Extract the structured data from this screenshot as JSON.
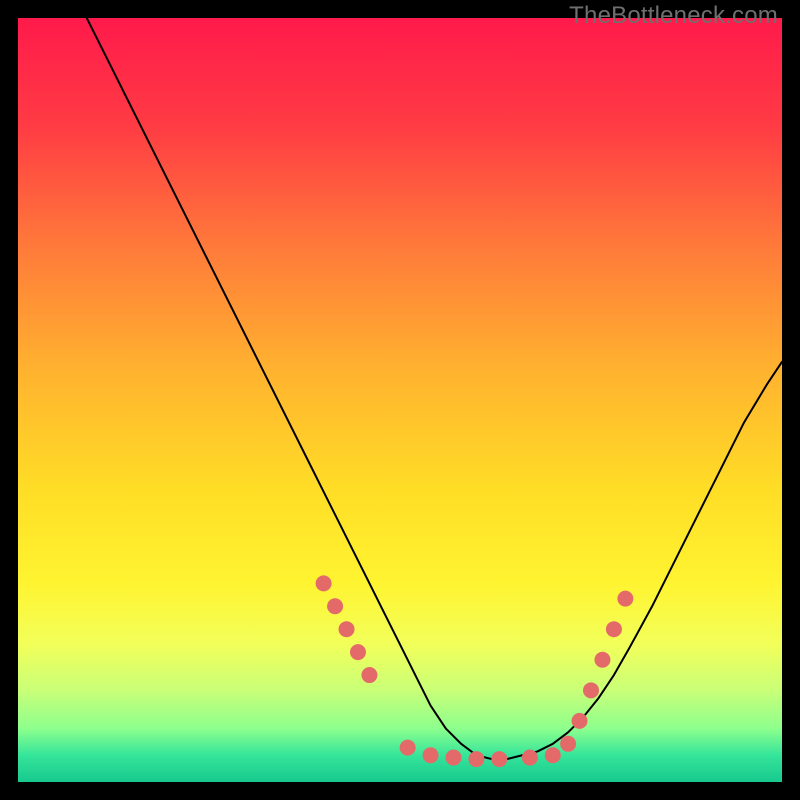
{
  "watermark": "TheBottleneck.com",
  "chart_data": {
    "type": "line",
    "title": "",
    "xlabel": "",
    "ylabel": "",
    "xlim": [
      0,
      100
    ],
    "ylim": [
      0,
      100
    ],
    "background_gradient": {
      "stops": [
        {
          "offset": 0.0,
          "color": "#ff1a4b"
        },
        {
          "offset": 0.14,
          "color": "#ff3b44"
        },
        {
          "offset": 0.3,
          "color": "#ff7a3a"
        },
        {
          "offset": 0.46,
          "color": "#ffb22f"
        },
        {
          "offset": 0.62,
          "color": "#ffde26"
        },
        {
          "offset": 0.74,
          "color": "#fff431"
        },
        {
          "offset": 0.82,
          "color": "#f2ff5a"
        },
        {
          "offset": 0.88,
          "color": "#c9ff77"
        },
        {
          "offset": 0.93,
          "color": "#8dff8d"
        },
        {
          "offset": 0.965,
          "color": "#35e59a"
        },
        {
          "offset": 1.0,
          "color": "#17c98e"
        }
      ]
    },
    "series": [
      {
        "name": "curve",
        "color": "#000000",
        "stroke_width": 2,
        "x": [
          9,
          12,
          16,
          20,
          24,
          28,
          32,
          36,
          38,
          40,
          42,
          44,
          46,
          48,
          50,
          52,
          54,
          56,
          58,
          60,
          62,
          64,
          66,
          68,
          70,
          72,
          74,
          76,
          78,
          80,
          83,
          86,
          89,
          92,
          95,
          98,
          100
        ],
        "y": [
          100,
          94,
          86,
          78,
          70,
          62,
          54,
          46,
          42,
          38,
          34,
          30,
          26,
          22,
          18,
          14,
          10,
          7,
          5,
          3.5,
          3,
          3,
          3.5,
          4,
          5,
          6.5,
          8.5,
          11,
          14,
          17.5,
          23,
          29,
          35,
          41,
          47,
          52,
          55
        ]
      }
    ],
    "markers": {
      "name": "dots",
      "color": "#e46a6a",
      "radius": 8,
      "points": [
        {
          "x": 40.0,
          "y": 26.0
        },
        {
          "x": 41.5,
          "y": 23.0
        },
        {
          "x": 43.0,
          "y": 20.0
        },
        {
          "x": 44.5,
          "y": 17.0
        },
        {
          "x": 46.0,
          "y": 14.0
        },
        {
          "x": 51.0,
          "y": 4.5
        },
        {
          "x": 54.0,
          "y": 3.5
        },
        {
          "x": 57.0,
          "y": 3.2
        },
        {
          "x": 60.0,
          "y": 3.0
        },
        {
          "x": 63.0,
          "y": 3.0
        },
        {
          "x": 67.0,
          "y": 3.2
        },
        {
          "x": 70.0,
          "y": 3.5
        },
        {
          "x": 72.0,
          "y": 5.0
        },
        {
          "x": 73.5,
          "y": 8.0
        },
        {
          "x": 75.0,
          "y": 12.0
        },
        {
          "x": 76.5,
          "y": 16.0
        },
        {
          "x": 78.0,
          "y": 20.0
        },
        {
          "x": 79.5,
          "y": 24.0
        }
      ]
    }
  }
}
